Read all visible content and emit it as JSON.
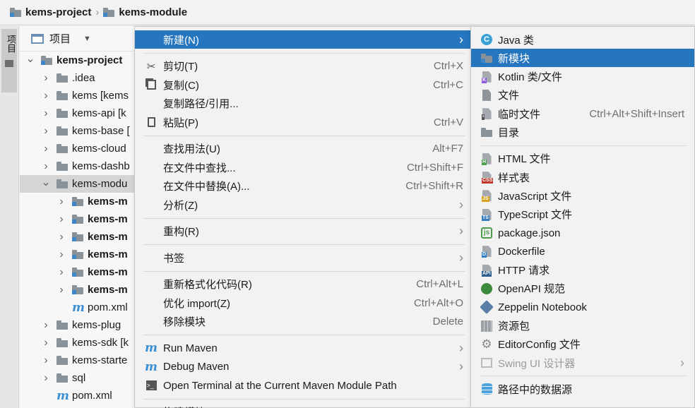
{
  "breadcrumb": {
    "project": "kems-project",
    "module": "kems-module"
  },
  "left_strip": {
    "tab_label": "项目"
  },
  "panel": {
    "title": "项目",
    "tree": [
      {
        "label": "kems-project",
        "bold": true,
        "arrow": "down",
        "indent": 0,
        "icon": "module-folder"
      },
      {
        "label": ".idea",
        "bold": false,
        "arrow": "right",
        "indent": 1,
        "icon": "folder"
      },
      {
        "label": "kems [kems",
        "bold": false,
        "arrow": "right",
        "indent": 1,
        "icon": "folder"
      },
      {
        "label": "kems-api [k",
        "bold": false,
        "arrow": "right",
        "indent": 1,
        "icon": "folder"
      },
      {
        "label": "kems-base [",
        "bold": false,
        "arrow": "right",
        "indent": 1,
        "icon": "folder"
      },
      {
        "label": "kems-cloud",
        "bold": false,
        "arrow": "right",
        "indent": 1,
        "icon": "folder"
      },
      {
        "label": "kems-dashb",
        "bold": false,
        "arrow": "right",
        "indent": 1,
        "icon": "folder"
      },
      {
        "label": "kems-modu",
        "bold": false,
        "arrow": "down",
        "indent": 1,
        "icon": "folder",
        "selected": true
      },
      {
        "label": "kems-m",
        "bold": true,
        "arrow": "right",
        "indent": 2,
        "icon": "module-folder"
      },
      {
        "label": "kems-m",
        "bold": true,
        "arrow": "right",
        "indent": 2,
        "icon": "module-folder"
      },
      {
        "label": "kems-m",
        "bold": true,
        "arrow": "right",
        "indent": 2,
        "icon": "module-folder"
      },
      {
        "label": "kems-m",
        "bold": true,
        "arrow": "right",
        "indent": 2,
        "icon": "module-folder"
      },
      {
        "label": "kems-m",
        "bold": true,
        "arrow": "right",
        "indent": 2,
        "icon": "module-folder"
      },
      {
        "label": "kems-m",
        "bold": true,
        "arrow": "right",
        "indent": 2,
        "icon": "module-folder"
      },
      {
        "label": "pom.xml",
        "bold": false,
        "arrow": "",
        "indent": 2,
        "icon": "maven"
      },
      {
        "label": "kems-plug",
        "bold": false,
        "arrow": "right",
        "indent": 1,
        "icon": "folder"
      },
      {
        "label": "kems-sdk [k",
        "bold": false,
        "arrow": "right",
        "indent": 1,
        "icon": "folder"
      },
      {
        "label": "kems-starte",
        "bold": false,
        "arrow": "right",
        "indent": 1,
        "icon": "folder"
      },
      {
        "label": "sql",
        "bold": false,
        "arrow": "right",
        "indent": 1,
        "icon": "folder"
      },
      {
        "label": "pom.xml",
        "bold": false,
        "arrow": "",
        "indent": 1,
        "icon": "maven"
      }
    ]
  },
  "menu": {
    "items": [
      {
        "label": "新建(N)",
        "shortcut": "",
        "submenu": true,
        "icon": "",
        "highlight": true,
        "name": "new"
      },
      {
        "sep": true
      },
      {
        "label": "剪切(T)",
        "shortcut": "Ctrl+X",
        "icon": "scissors",
        "name": "cut"
      },
      {
        "label": "复制(C)",
        "shortcut": "Ctrl+C",
        "icon": "copy",
        "name": "copy"
      },
      {
        "label": "复制路径/引用...",
        "shortcut": "",
        "icon": "",
        "name": "copy-path"
      },
      {
        "label": "粘贴(P)",
        "shortcut": "Ctrl+V",
        "icon": "clipboard",
        "name": "paste"
      },
      {
        "sep": true
      },
      {
        "label": "查找用法(U)",
        "shortcut": "Alt+F7",
        "icon": "",
        "name": "find-usages"
      },
      {
        "label": "在文件中查找...",
        "shortcut": "Ctrl+Shift+F",
        "icon": "",
        "name": "find-in-files"
      },
      {
        "label": "在文件中替换(A)...",
        "shortcut": "Ctrl+Shift+R",
        "icon": "",
        "name": "replace-in-files"
      },
      {
        "label": "分析(Z)",
        "shortcut": "",
        "submenu": true,
        "icon": "",
        "name": "analyze"
      },
      {
        "sep": true
      },
      {
        "label": "重构(R)",
        "shortcut": "",
        "submenu": true,
        "icon": "",
        "name": "refactor"
      },
      {
        "sep": true
      },
      {
        "label": "书签",
        "shortcut": "",
        "submenu": true,
        "icon": "",
        "name": "bookmarks"
      },
      {
        "sep": true
      },
      {
        "label": "重新格式化代码(R)",
        "shortcut": "Ctrl+Alt+L",
        "icon": "",
        "name": "reformat-code"
      },
      {
        "label": "优化 import(Z)",
        "shortcut": "Ctrl+Alt+O",
        "icon": "",
        "name": "optimize-imports"
      },
      {
        "label": "移除模块",
        "shortcut": "Delete",
        "icon": "",
        "name": "remove-module"
      },
      {
        "sep": true
      },
      {
        "label": "Run Maven",
        "shortcut": "",
        "submenu": true,
        "icon": "maven-run",
        "name": "run-maven"
      },
      {
        "label": "Debug Maven",
        "shortcut": "",
        "submenu": true,
        "icon": "maven-debug",
        "name": "debug-maven"
      },
      {
        "label": "Open Terminal at the Current Maven Module Path",
        "shortcut": "",
        "icon": "terminal",
        "name": "open-terminal"
      },
      {
        "sep": true
      },
      {
        "label": "构建模块 'kems-module-parent'(M)",
        "shortcut": "",
        "icon": "",
        "name": "build-module",
        "partial": true
      }
    ]
  },
  "submenu": {
    "items": [
      {
        "label": "Java 类",
        "shortcut": "",
        "icon": "java-class",
        "name": "java-class"
      },
      {
        "label": "新模块",
        "shortcut": "",
        "icon": "module",
        "name": "new-module",
        "highlight": true
      },
      {
        "label": "Kotlin 类/文件",
        "shortcut": "",
        "icon": "kotlin",
        "name": "kotlin"
      },
      {
        "label": "文件",
        "shortcut": "",
        "icon": "file",
        "name": "file"
      },
      {
        "label": "临时文件",
        "shortcut": "Ctrl+Alt+Shift+Insert",
        "icon": "scratch",
        "name": "scratch-file"
      },
      {
        "label": "目录",
        "shortcut": "",
        "icon": "folder",
        "name": "directory"
      },
      {
        "sep": true
      },
      {
        "label": "HTML 文件",
        "shortcut": "",
        "icon": "html",
        "name": "html-file"
      },
      {
        "label": "样式表",
        "shortcut": "",
        "icon": "css",
        "name": "stylesheet"
      },
      {
        "label": "JavaScript 文件",
        "shortcut": "",
        "icon": "js",
        "name": "javascript-file"
      },
      {
        "label": "TypeScript 文件",
        "shortcut": "",
        "icon": "ts",
        "name": "typescript-file"
      },
      {
        "label": "package.json",
        "shortcut": "",
        "icon": "nodejs",
        "name": "package-json"
      },
      {
        "label": "Dockerfile",
        "shortcut": "",
        "icon": "docker",
        "name": "dockerfile"
      },
      {
        "label": "HTTP 请求",
        "shortcut": "",
        "icon": "api",
        "name": "http-request"
      },
      {
        "label": "OpenAPI 规范",
        "shortcut": "",
        "icon": "openapi",
        "name": "openapi"
      },
      {
        "label": "Zeppelin Notebook",
        "shortcut": "",
        "icon": "zeppelin",
        "name": "zeppelin"
      },
      {
        "label": "资源包",
        "shortcut": "",
        "icon": "resource-bundle",
        "name": "resource-bundle"
      },
      {
        "label": "EditorConfig 文件",
        "shortcut": "",
        "icon": "gear",
        "name": "editorconfig"
      },
      {
        "label": "Swing UI 设计器",
        "shortcut": "",
        "icon": "swing",
        "name": "swing-ui",
        "submenu": true,
        "disabled": true
      },
      {
        "sep": true
      },
      {
        "label": "路径中的数据源",
        "shortcut": "",
        "icon": "database",
        "name": "data-source"
      }
    ]
  },
  "colors": {
    "highlight": "#2675bf",
    "maven": "#3b8fd5",
    "module_dot": "#3e86c8"
  }
}
